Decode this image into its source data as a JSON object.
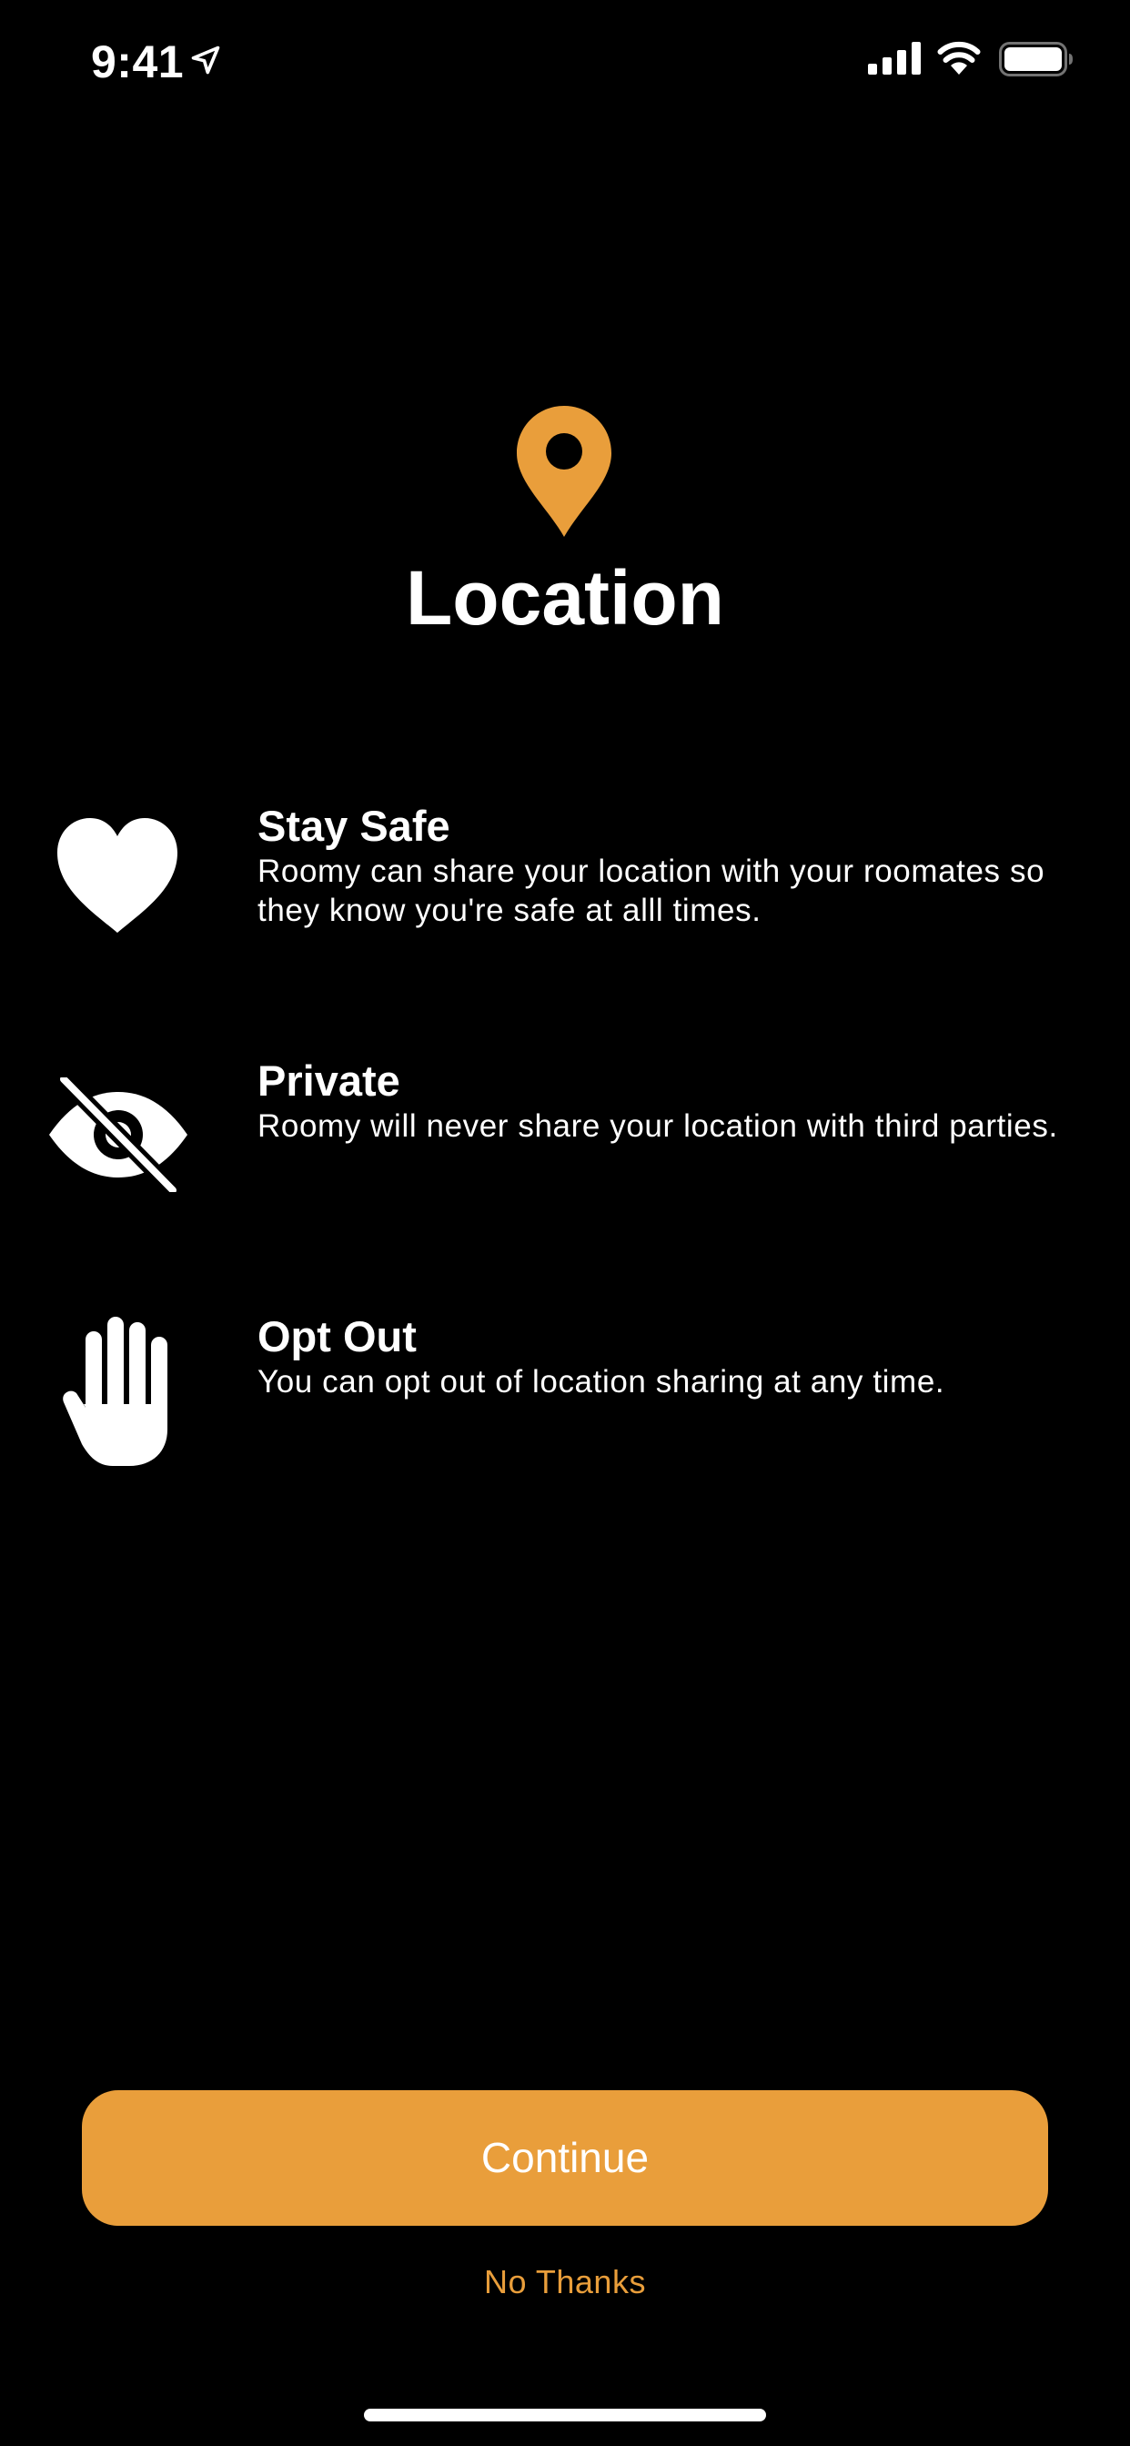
{
  "status_bar": {
    "time": "9:41",
    "icons": [
      "location-arrow-icon",
      "signal-icon",
      "wifi-icon",
      "battery-icon"
    ]
  },
  "header": {
    "icon": "location-pin-icon",
    "title": "Location"
  },
  "features": [
    {
      "icon": "heart-icon",
      "title": "Stay Safe",
      "description": "Roomy can share your location with your roomates so they know you're safe at alll times."
    },
    {
      "icon": "eye-slash-icon",
      "title": "Private",
      "description": "Roomy will never share your location with third parties."
    },
    {
      "icon": "raised-hand-icon",
      "title": "Opt Out",
      "description": "You can opt out of location sharing at any time."
    }
  ],
  "actions": {
    "continue_label": "Continue",
    "no_thanks_label": "No Thanks"
  },
  "colors": {
    "accent": "#e99e3b",
    "background": "#000000",
    "text": "#ffffff"
  }
}
